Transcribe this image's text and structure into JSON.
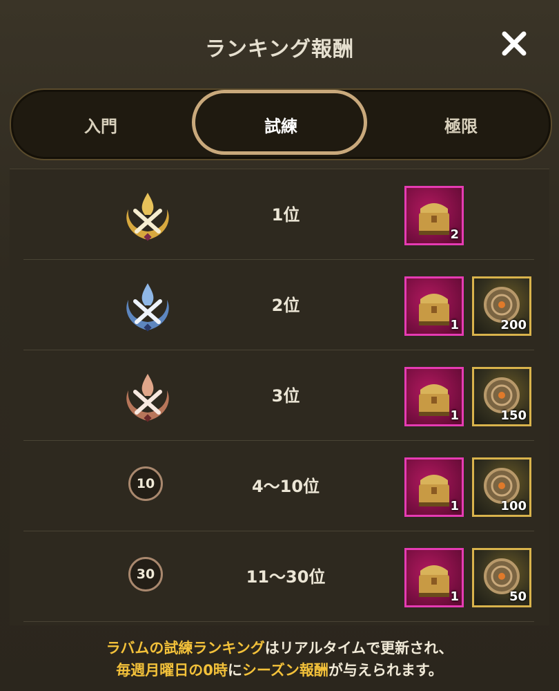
{
  "header": {
    "title": "ランキング報酬"
  },
  "tabs": [
    {
      "label": "入門",
      "active": false
    },
    {
      "label": "試練",
      "active": true
    },
    {
      "label": "極限",
      "active": false
    }
  ],
  "rows": [
    {
      "rank_badge": "gold-medal",
      "rank_label": "1位",
      "rewards": [
        {
          "type": "chest",
          "qty": "2"
        }
      ]
    },
    {
      "rank_badge": "silver-medal",
      "rank_label": "2位",
      "rewards": [
        {
          "type": "chest",
          "qty": "1"
        },
        {
          "type": "coin",
          "qty": "200"
        }
      ]
    },
    {
      "rank_badge": "bronze-medal",
      "rank_label": "3位",
      "rewards": [
        {
          "type": "chest",
          "qty": "1"
        },
        {
          "type": "coin",
          "qty": "150"
        }
      ]
    },
    {
      "rank_badge": "10",
      "rank_label": "4〜10位",
      "rewards": [
        {
          "type": "chest",
          "qty": "1"
        },
        {
          "type": "coin",
          "qty": "100"
        }
      ]
    },
    {
      "rank_badge": "30",
      "rank_label": "11〜30位",
      "rewards": [
        {
          "type": "chest",
          "qty": "1"
        },
        {
          "type": "coin",
          "qty": "50"
        }
      ]
    }
  ],
  "footer": {
    "line1_a": "ラバムの試練ランキング",
    "line1_b": "はリアルタイムで更新され、",
    "line2_a": "毎週月曜日の0時",
    "line2_b": "に",
    "line2_c": "シーズン報酬",
    "line2_d": "が与えられます。"
  },
  "colors": {
    "gold": "#e8c25a",
    "silver": "#7fa6d6",
    "bronze": "#d6997a",
    "highlight": "#f3c13a",
    "tab_active_border": "#c9a97c",
    "chest_border": "#e63bb3",
    "coin_border": "#d9b34c"
  },
  "icons": {
    "close": "close-x-icon",
    "chest": "treasure-chest-icon",
    "coin": "gear-medallion-icon"
  }
}
